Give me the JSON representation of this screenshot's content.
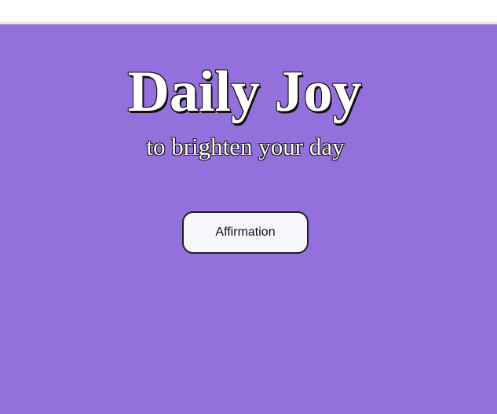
{
  "header": {
    "title": "Daily Joy",
    "subtitle": "to brighten your day"
  },
  "actions": {
    "affirmation_label": "Affirmation"
  },
  "colors": {
    "background": "#9370db",
    "button_bg": "#f7f7fb",
    "text": "#ffffff"
  }
}
